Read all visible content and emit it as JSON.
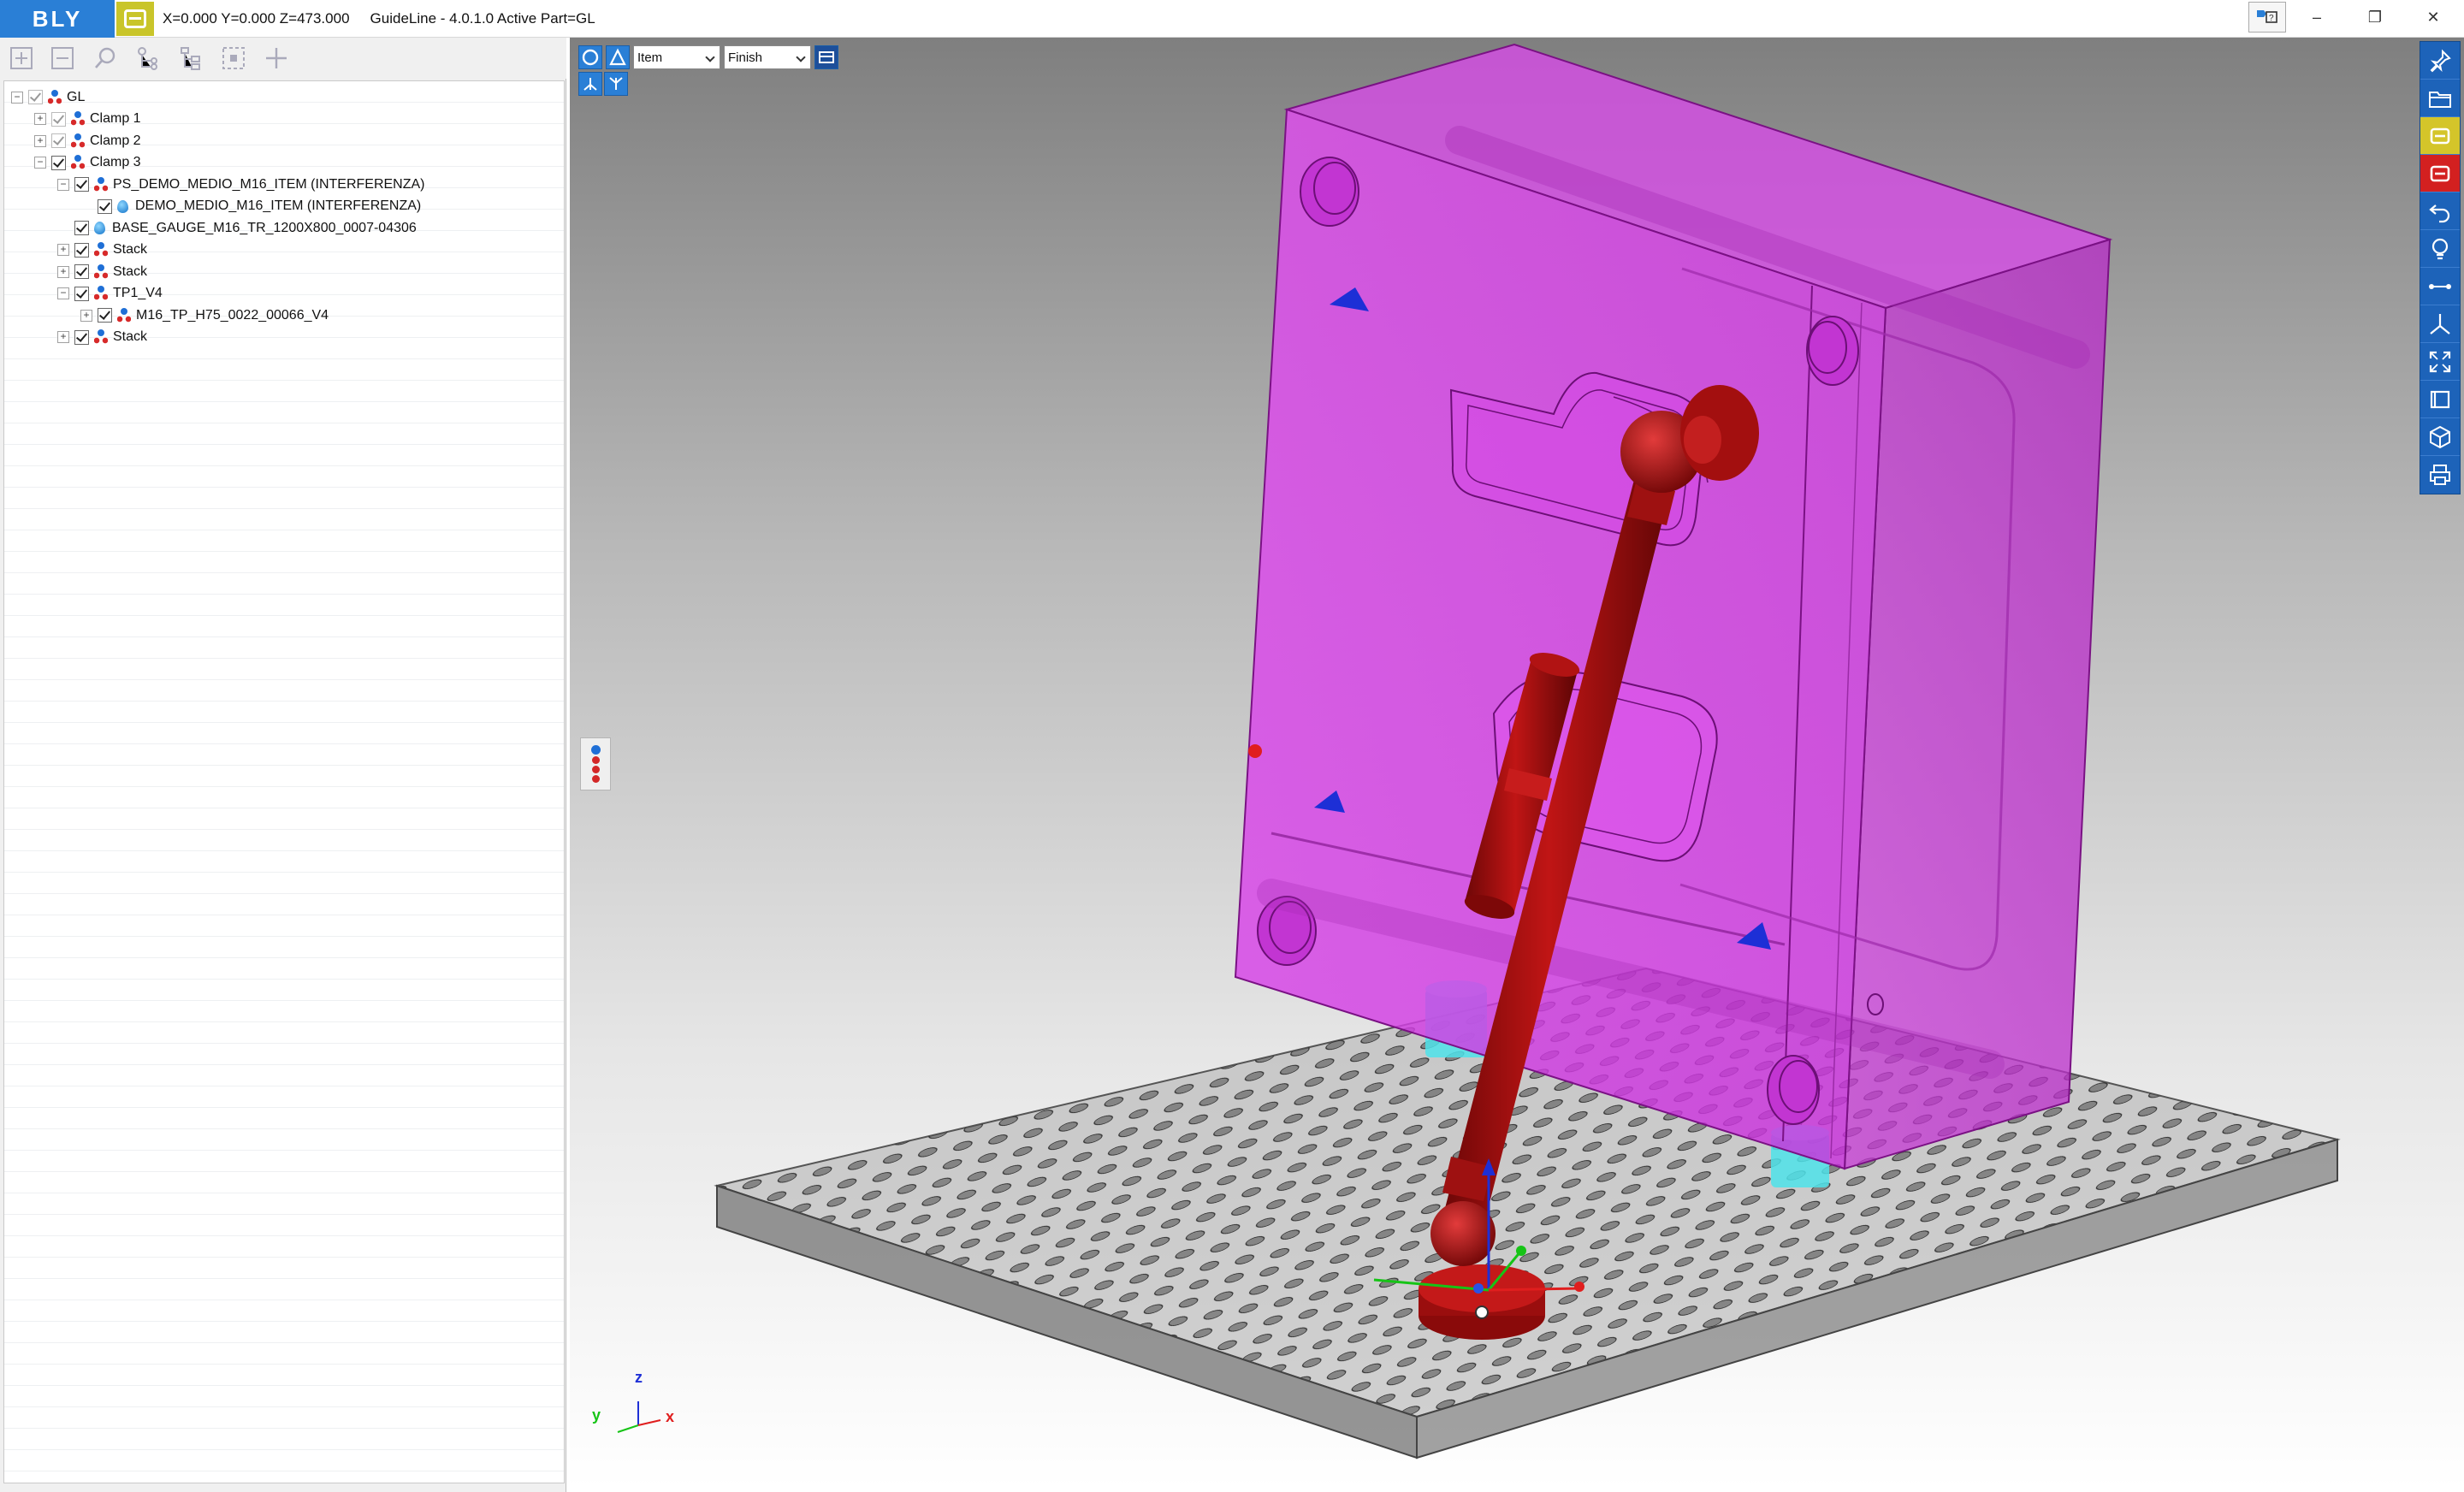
{
  "app": {
    "logo_text": "BLY",
    "coords": "X=0.000 Y=0.000 Z=473.000",
    "title": "GuideLine - 4.0.1.0 Active Part=GL"
  },
  "window_controls": {
    "minimize": "–",
    "maximize": "❐",
    "close": "✕"
  },
  "tree": {
    "items": [
      {
        "label": "GL",
        "depth": 0,
        "expander": "−",
        "icon": "group-icon"
      },
      {
        "label": "Clamp 1",
        "depth": 1,
        "expander": "+",
        "icon": "group-icon"
      },
      {
        "label": "Clamp 2",
        "depth": 1,
        "expander": "+",
        "icon": "group-icon"
      },
      {
        "label": "Clamp 3",
        "depth": 1,
        "expander": "−",
        "icon": "group-icon"
      },
      {
        "label": "PS_DEMO_MEDIO_M16_ITEM (INTERFERENZA)",
        "depth": 2,
        "expander": "−",
        "icon": "group-icon"
      },
      {
        "label": "DEMO_MEDIO_M16_ITEM (INTERFERENZA)",
        "depth": 3,
        "expander": "",
        "icon": "part-icon"
      },
      {
        "label": "BASE_GAUGE_M16_TR_1200X800_0007-04306",
        "depth": 2,
        "expander": "",
        "icon": "part-icon"
      },
      {
        "label": "Stack",
        "depth": 2,
        "expander": "+",
        "icon": "group-icon"
      },
      {
        "label": "Stack",
        "depth": 2,
        "expander": "+",
        "icon": "group-icon"
      },
      {
        "label": "TP1_V4",
        "depth": 2,
        "expander": "−",
        "icon": "group-icon"
      },
      {
        "label": "M16_TP_H75_0022_00066_V4",
        "depth": 3,
        "expander": "+",
        "icon": "group-icon"
      },
      {
        "label": "Stack",
        "depth": 2,
        "expander": "+",
        "icon": "group-icon"
      }
    ]
  },
  "viewport": {
    "item_select": "Item",
    "finish_select": "Finish",
    "axes": {
      "z": "z",
      "y": "y",
      "x": "x"
    }
  },
  "colors": {
    "accent": "#2a7fd6",
    "mold": "#d33ae0",
    "clamp": "#a20e0e",
    "plate": "#6e6e6e",
    "support": "#3fd6e0"
  }
}
